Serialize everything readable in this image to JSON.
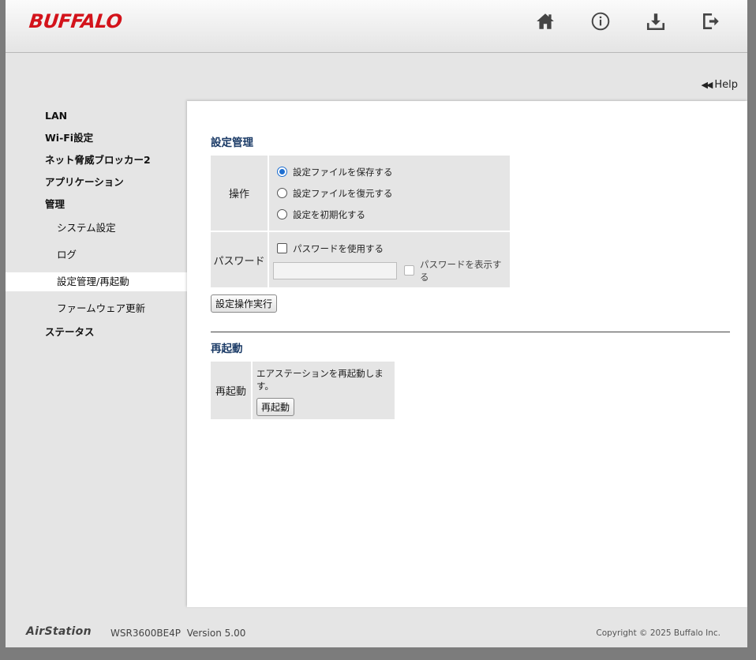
{
  "header": {
    "brand": "BUFFALO",
    "icons": [
      "home-icon",
      "info-icon",
      "download-icon",
      "logout-icon"
    ]
  },
  "help": {
    "arrows": "◀◀",
    "label": "Help"
  },
  "sidebar": {
    "items": [
      {
        "label": "LAN"
      },
      {
        "label": "Wi-Fi設定"
      },
      {
        "label": "ネット脅威ブロッカー2"
      },
      {
        "label": "アプリケーション"
      },
      {
        "label": "管理"
      }
    ],
    "sub_items": [
      {
        "label": "システム設定"
      },
      {
        "label": "ログ"
      },
      {
        "label": "設定管理/再起動"
      },
      {
        "label": "ファームウェア更新"
      }
    ],
    "last_item": {
      "label": "ステータス"
    }
  },
  "settings": {
    "title": "設定管理",
    "operation_label": "操作",
    "options": [
      {
        "label": "設定ファイルを保存する",
        "selected": true
      },
      {
        "label": "設定ファイルを復元する",
        "selected": false
      },
      {
        "label": "設定を初期化する",
        "selected": false
      }
    ],
    "password_label": "パスワード",
    "use_password_label": "パスワードを使用する",
    "password_value": "",
    "show_password_label": "パスワードを表示する",
    "execute_button": "設定操作実行"
  },
  "reboot": {
    "title": "再起動",
    "row_label": "再起動",
    "description": "エアステーションを再起動します。",
    "button": "再起動"
  },
  "footer": {
    "product": "AirStation",
    "model": "WSR3600BE4P",
    "version": "Version 5.00",
    "copyright": "Copyright © 2025 Buffalo Inc."
  },
  "colors": {
    "brand": "#d3131b",
    "section_title": "#1a3a66",
    "radio_selected": "#1f6fd0"
  }
}
